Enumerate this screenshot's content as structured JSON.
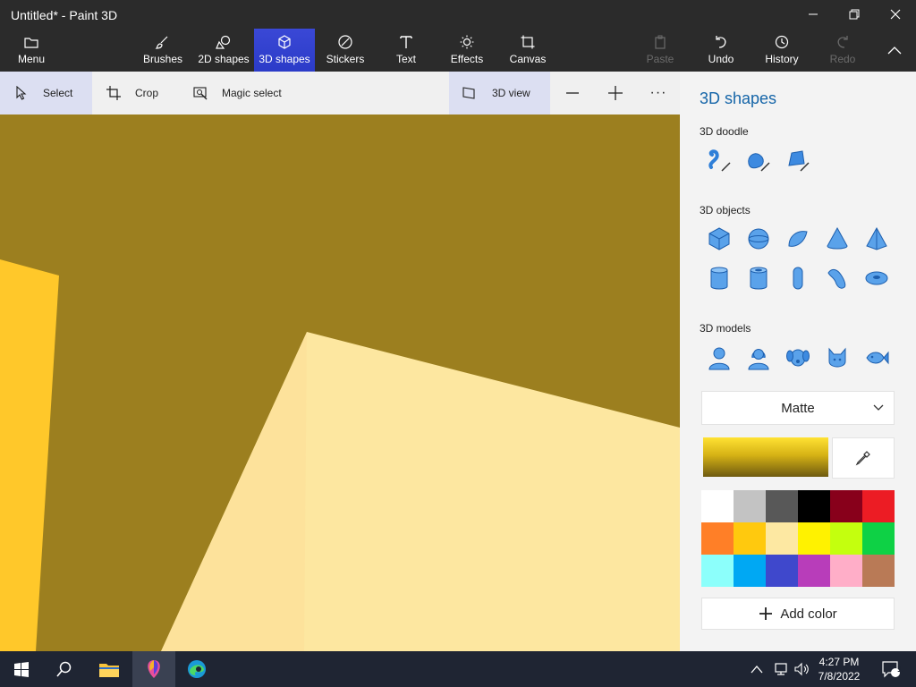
{
  "window": {
    "title": "Untitled* - Paint 3D"
  },
  "ribbon": {
    "menu": "Menu",
    "tools": [
      "Brushes",
      "2D shapes",
      "3D shapes",
      "Stickers",
      "Text",
      "Effects",
      "Canvas"
    ],
    "right": [
      "Paste",
      "Undo",
      "History",
      "Redo"
    ]
  },
  "toolbar": {
    "select": "Select",
    "crop": "Crop",
    "magic_select": "Magic select",
    "view3d": "3D view",
    "zoom_out": "—",
    "zoom_in": "+",
    "more": "···"
  },
  "panel": {
    "title": "3D shapes",
    "doodle_label": "3D doodle",
    "objects_label": "3D objects",
    "models_label": "3D models",
    "material": "Matte",
    "add_color": "Add color",
    "palette": [
      "#ffffff",
      "#c3c3c3",
      "#585858",
      "#000000",
      "#88001b",
      "#ec1c24",
      "#ff7f27",
      "#ffc90e",
      "#fde8a2",
      "#fff200",
      "#c4ff0e",
      "#0ed145",
      "#8cfffb",
      "#00a8f3",
      "#3f48cc",
      "#b83dba",
      "#ffaec8",
      "#b97a56"
    ]
  },
  "taskbar": {
    "time": "4:27 PM",
    "date": "7/8/2022",
    "notification_count": "1"
  },
  "colors": {
    "accent": "#1565a8",
    "ribbon_bg": "#2b2b2b",
    "canvas_bg": "#9c7f1f",
    "shape_light": "#fde7a0",
    "shape_yellow": "#ffc82a"
  }
}
